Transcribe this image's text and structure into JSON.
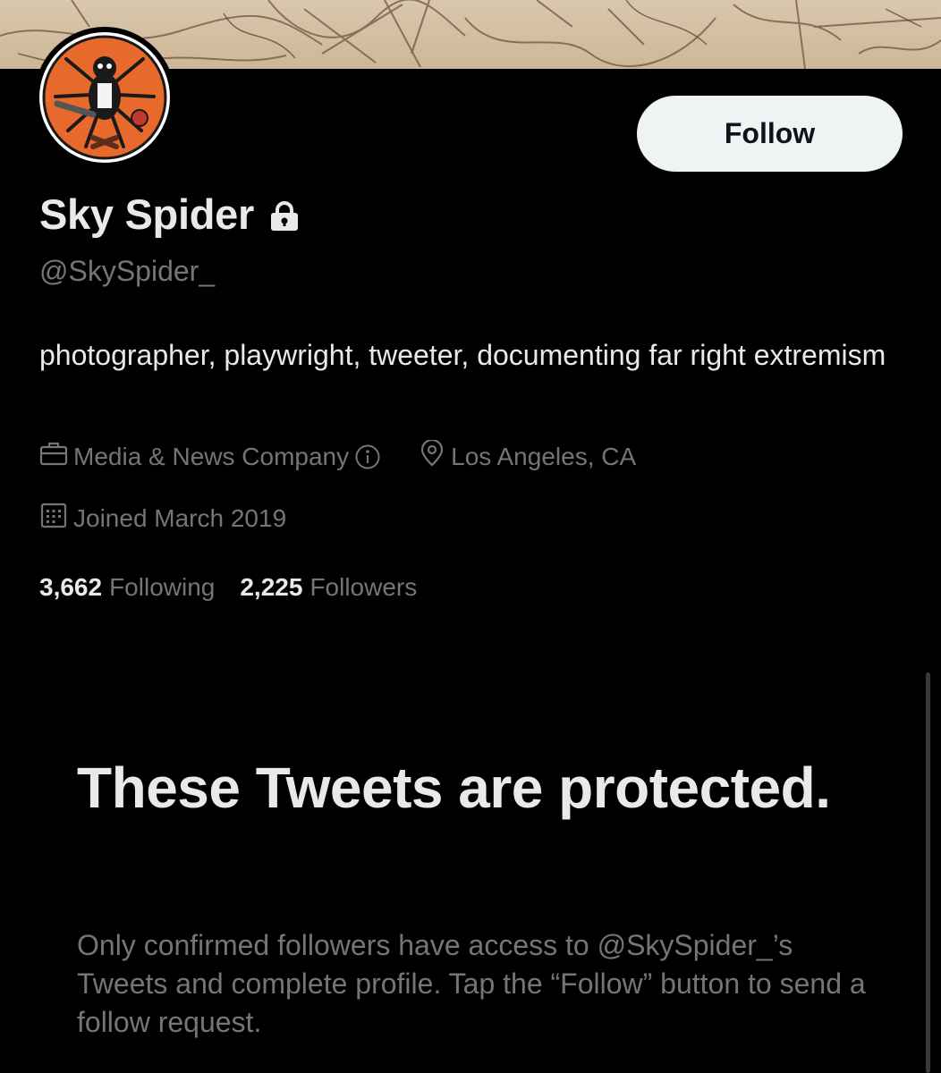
{
  "profile": {
    "display_name": "Sky Spider",
    "handle": "@SkySpider_",
    "bio": "photographer, playwright, tweeter, documenting far right extremism",
    "category": "Media & News Company",
    "location": "Los Angeles, CA",
    "joined": "Joined March 2019",
    "following_count": "3,662",
    "following_label": "Following",
    "followers_count": "2,225",
    "followers_label": "Followers"
  },
  "actions": {
    "follow_label": "Follow"
  },
  "protected_notice": {
    "title": "These Tweets are protected.",
    "message": "Only confirmed followers have access to @SkySpider_’s Tweets and complete profile. Tap the “Follow” button to send a follow request."
  },
  "icons": {
    "lock": "lock-icon",
    "category": "briefcase-icon",
    "info": "info-icon",
    "location": "location-pin-icon",
    "joined": "calendar-icon"
  },
  "colors": {
    "background": "#000000",
    "primary_text": "#e7e9ea",
    "secondary_text": "#71767b",
    "follow_button_bg": "#eff3f4",
    "follow_button_text": "#0f1419",
    "avatar_accent": "#e8692c"
  }
}
